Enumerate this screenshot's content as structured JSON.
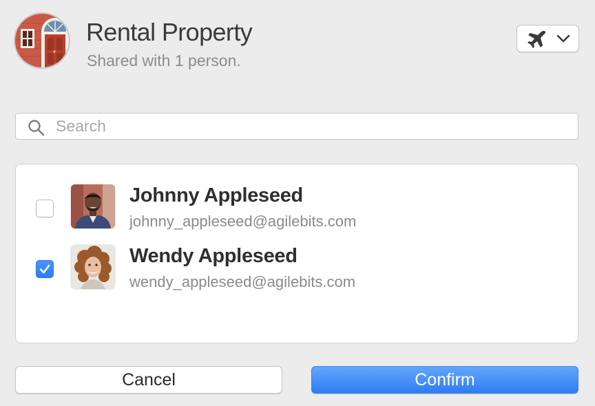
{
  "header": {
    "title": "Rental Property",
    "subtitle": "Shared with 1 person.",
    "vault_icon": "house-door-icon",
    "mode_button": {
      "icon": "airplane-icon",
      "chevron": "chevron-down-icon"
    }
  },
  "search": {
    "placeholder": "Search",
    "value": ""
  },
  "people": [
    {
      "name": "Johnny Appleseed",
      "email": "johnny_appleseed@agilebits.com",
      "checked": false
    },
    {
      "name": "Wendy Appleseed",
      "email": "wendy_appleseed@agilebits.com",
      "checked": true
    }
  ],
  "buttons": {
    "cancel": "Cancel",
    "confirm": "Confirm"
  },
  "colors": {
    "accent": "#2f7df5",
    "background": "#ececec"
  }
}
